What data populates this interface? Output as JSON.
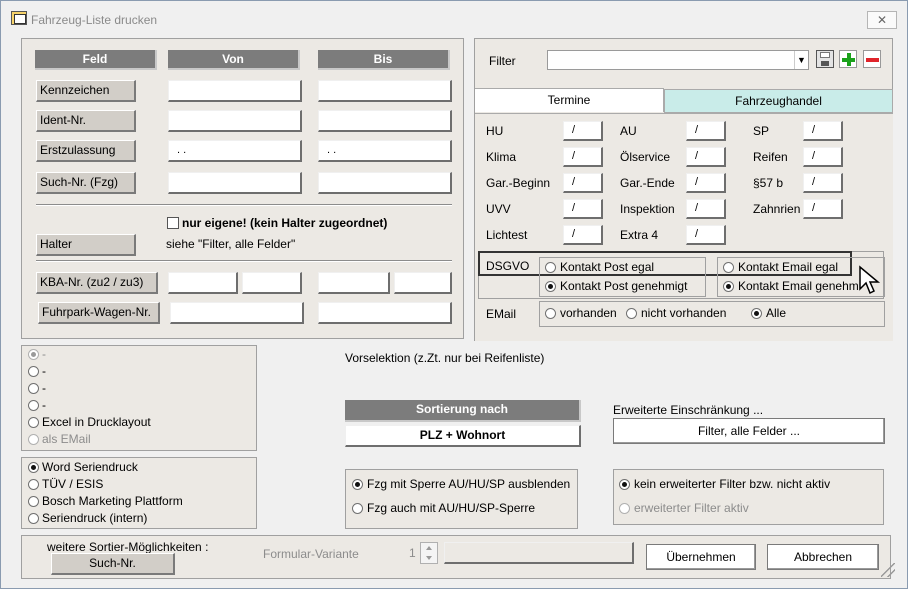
{
  "window": {
    "title": "Fahrzeug-Liste drucken",
    "close_label": "✕"
  },
  "grid": {
    "headers": {
      "feld": "Feld",
      "von": "Von",
      "bis": "Bis"
    },
    "kennzeichen": "Kennzeichen",
    "ident": "Ident-Nr.",
    "erstzulassung": "Erstzulassung",
    "erst_von": ". .",
    "erst_bis": ". .",
    "such": "Such-Nr. (Fzg)",
    "nur_eigene": "nur eigene! (kein Halter zugeordnet)",
    "halter": "Halter",
    "halter_hint": "siehe \"Filter, alle Felder\"",
    "kba": "KBA-Nr. (zu2 / zu3)",
    "fuhrpark": "Fuhrpark-Wagen-Nr."
  },
  "filter": {
    "label": "Filter",
    "value": ""
  },
  "tabs": {
    "termine": "Termine",
    "fahrzeughandel": "Fahrzeughandel"
  },
  "termine": {
    "slash": "/",
    "row1": [
      "HU",
      "AU",
      "SP"
    ],
    "row2": [
      "Klima",
      "Ölservice",
      "Reifen"
    ],
    "row3": [
      "Gar.-Beginn",
      "Gar.-Ende",
      "§57 b"
    ],
    "row4": [
      "UVV",
      "Inspektion",
      "Zahnrien"
    ],
    "row5": [
      "Lichtest",
      "Extra 4"
    ]
  },
  "dsgvo": {
    "label": "DSGVO",
    "post_egal": "Kontakt Post egal",
    "post_gen": "Kontakt Post genehmigt",
    "email_egal": "Kontakt Email egal",
    "email_gen": "Kontakt Email genehm"
  },
  "email": {
    "label": "EMail",
    "vorhanden": "vorhanden",
    "nicht": "nicht vorhanden",
    "alle": "Alle"
  },
  "output": {
    "o1": "-",
    "o2": "-",
    "o3": "-",
    "o4": "-",
    "excel": "Excel in Drucklayout",
    "emailopt": "als EMail"
  },
  "merge": {
    "word": "Word Seriendruck",
    "tuv": "TÜV / ESIS",
    "bosch": "Bosch Marketing Plattform",
    "intern": "Seriendruck (intern)"
  },
  "vorselektion": "Vorselektion (z.Zt. nur bei Reifenliste)",
  "sort": {
    "header": "Sortierung nach",
    "value": "PLZ + Wohnort"
  },
  "sperre": {
    "ausblenden": "Fzg mit Sperre AU/HU/SP ausblenden",
    "auch": "Fzg auch mit AU/HU/SP-Sperre"
  },
  "erw": {
    "title": "Erweiterte Einschränkung ...",
    "button": "Filter, alle Felder ...",
    "kein": "kein erweiterter Filter bzw. nicht aktiv",
    "aktiv": "erweiterter Filter aktiv"
  },
  "bottom": {
    "weitere": "weitere Sortier-Möglichkeiten :",
    "such": "Such-Nr.",
    "formular": "Formular-Variante",
    "variant": "1",
    "uebernehmen": "Übernehmen",
    "abbrechen": "Abbrechen"
  },
  "colors": {
    "header_bg": "#7c7c7c",
    "panel_bg": "#ece9e4",
    "tab_active": "#ffffff",
    "tab_inactive": "#c9ece9",
    "highlight": "#333333"
  }
}
